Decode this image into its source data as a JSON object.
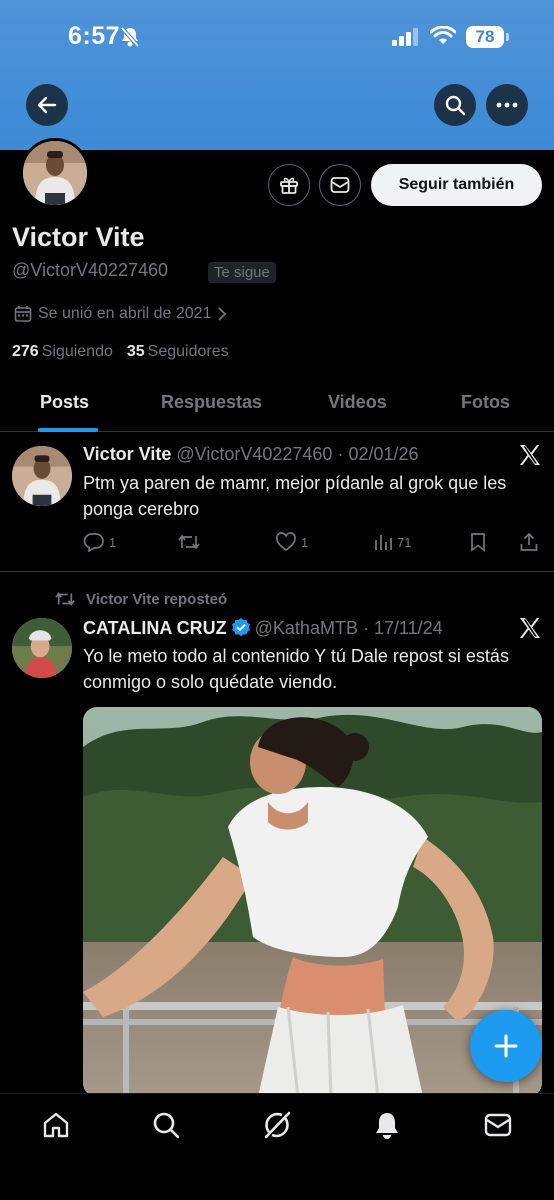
{
  "status_bar": {
    "time": "6:57",
    "battery": "78"
  },
  "profile": {
    "name": "Victor Vite",
    "handle": "@VictorV40227460",
    "follows_you": "Te sigue",
    "joined": "Se unió en abril de 2021",
    "following_count": "276",
    "following_label": "Siguiendo",
    "followers_count": "35",
    "followers_label": "Seguidores",
    "follow_button": "Seguir también"
  },
  "tabs": [
    {
      "label": "Posts",
      "active": true
    },
    {
      "label": "Respuestas",
      "active": false
    },
    {
      "label": "Videos",
      "active": false
    },
    {
      "label": "Fotos",
      "active": false
    }
  ],
  "posts": [
    {
      "author": "Victor Vite",
      "handle": "@VictorV40227460",
      "date": "02/01/26",
      "text": "Ptm ya paren de mamr, mejor pídanle al grok que les ponga cerebro",
      "replies": "1",
      "reposts": "",
      "likes": "1",
      "views": "71"
    },
    {
      "repost_label": "Victor Vite reposteó",
      "author": "CATALINA CRUZ",
      "verified": true,
      "handle": "@KathaMTB",
      "date": "17/11/24",
      "text": "Yo le meto todo al contenido Y tú Dale repost si estás conmigo o solo quédate viendo."
    }
  ],
  "colors": {
    "accent": "#1d9bf0",
    "banner": "#3d8ad6",
    "muted": "#71767b",
    "text": "#e7e9ea"
  },
  "icons": {
    "nav": [
      "home-icon",
      "search-icon",
      "grok-icon",
      "notifications-icon",
      "messages-icon"
    ],
    "header": [
      "back-arrow-icon",
      "search-icon",
      "more-icon"
    ]
  }
}
